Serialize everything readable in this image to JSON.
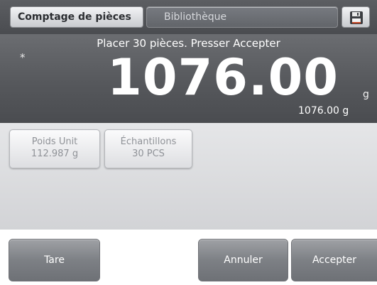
{
  "header": {
    "app_tab_label": "Comptage de pièces",
    "library_tab_label": "Bibliothèque",
    "save_icon": "floppy-disk-icon"
  },
  "display": {
    "prompt": "Placer 30 pièces. Presser Accepter",
    "stability_marker": "*",
    "reading": "1076.00",
    "unit": "g",
    "secondary_reading": "1076.00 g"
  },
  "info_buttons": [
    {
      "label": "Poids Unit",
      "value": "112.987 g"
    },
    {
      "label": "Échantillons",
      "value": "30 PCS"
    }
  ],
  "actions": {
    "tare_label": "Tare",
    "cancel_label": "Annuler",
    "accept_label": "Accepter"
  },
  "colors": {
    "display_bg": "#56585c",
    "button_gray": "#7d8085"
  }
}
